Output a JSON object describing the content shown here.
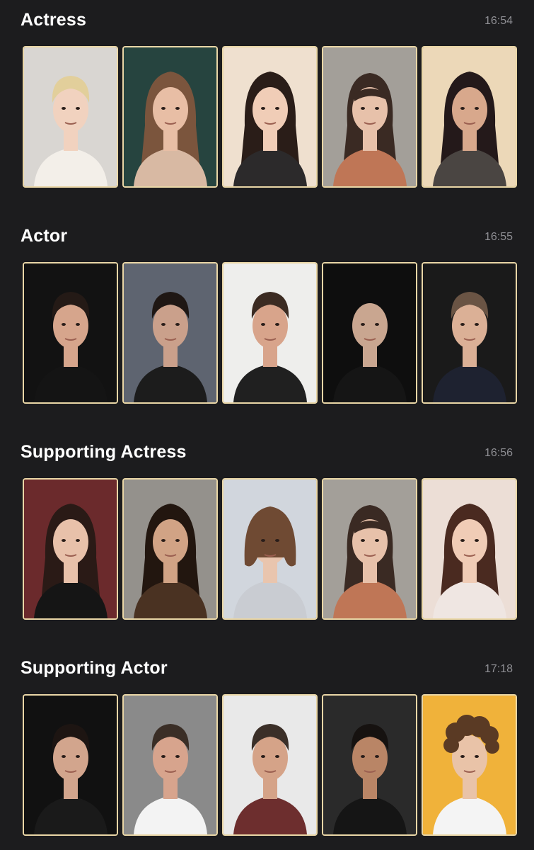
{
  "sections": [
    {
      "title": "Actress",
      "time": "16:54",
      "cards": [
        {
          "bg": "#d9d6d2",
          "skin": "#f1d2bf",
          "hair": "#e2cf9b",
          "cloth": "#f3efe9",
          "hair_style": "short"
        },
        {
          "bg": "#26443f",
          "skin": "#e8bea5",
          "hair": "#7b553d",
          "cloth": "#d8b9a3",
          "hair_style": "long"
        },
        {
          "bg": "#efe0cf",
          "skin": "#f0cdb7",
          "hair": "#2a1d18",
          "cloth": "#2c2a2b",
          "hair_style": "long"
        },
        {
          "bg": "#a39f99",
          "skin": "#e7c1aa",
          "hair": "#3a2a23",
          "cloth": "#bf7656",
          "hair_style": "bangs"
        },
        {
          "bg": "#ecd8b8",
          "skin": "#d8a88c",
          "hair": "#24191a",
          "cloth": "#4a4542",
          "hair_style": "long"
        }
      ]
    },
    {
      "title": "Actor",
      "time": "16:55",
      "cards": [
        {
          "bg": "#121212",
          "skin": "#d6a58c",
          "hair": "#241a16",
          "cloth": "#141414",
          "hair_style": "short"
        },
        {
          "bg": "#5e6470",
          "skin": "#caa08b",
          "hair": "#1f1714",
          "cloth": "#1c1c1c",
          "hair_style": "short"
        },
        {
          "bg": "#eeeeec",
          "skin": "#d8a48b",
          "hair": "#3b2b22",
          "cloth": "#202020",
          "hair_style": "short"
        },
        {
          "bg": "#0e0e0e",
          "skin": "#c9a690",
          "hair": "#c9a690",
          "cloth": "#151515",
          "hair_style": "bald"
        },
        {
          "bg": "#1a1a1a",
          "skin": "#dbb096",
          "hair": "#6a5444",
          "cloth": "#1e2230",
          "hair_style": "short"
        }
      ]
    },
    {
      "title": "Supporting Actress",
      "time": "16:56",
      "cards": [
        {
          "bg": "#6b2a2c",
          "skin": "#e8c1aa",
          "hair": "#2a1a16",
          "cloth": "#151515",
          "hair_style": "long"
        },
        {
          "bg": "#94918c",
          "skin": "#d1a385",
          "hair": "#22160f",
          "cloth": "#4a3222",
          "hair_style": "long"
        },
        {
          "bg": "#d1d6dd",
          "skin": "#e9c5ae",
          "hair": "#6f4a33",
          "cloth": "#c9ccd2",
          "hair_style": "bob"
        },
        {
          "bg": "#a39f99",
          "skin": "#e7c1aa",
          "hair": "#3a2a23",
          "cloth": "#bf7656",
          "hair_style": "bangs"
        },
        {
          "bg": "#ecded6",
          "skin": "#f0ccb6",
          "hair": "#4a2a20",
          "cloth": "#efe6e2",
          "hair_style": "long"
        }
      ]
    },
    {
      "title": "Supporting Actor",
      "time": "17:18",
      "cards": [
        {
          "bg": "#111111",
          "skin": "#d2a58d",
          "hair": "#1d1512",
          "cloth": "#1a1a1a",
          "hair_style": "short"
        },
        {
          "bg": "#8a8a8a",
          "skin": "#d7a48d",
          "hair": "#3a2e26",
          "cloth": "#f3f3f3",
          "hair_style": "short"
        },
        {
          "bg": "#e9e9e9",
          "skin": "#d5a388",
          "hair": "#3b2f28",
          "cloth": "#6d2e2e",
          "hair_style": "short"
        },
        {
          "bg": "#2a2a2a",
          "skin": "#b98566",
          "hair": "#161210",
          "cloth": "#151515",
          "hair_style": "short"
        },
        {
          "bg": "#f0b23a",
          "skin": "#e9c3a8",
          "hair": "#5a3a24",
          "cloth": "#f4f4f4",
          "hair_style": "curly"
        }
      ]
    }
  ]
}
